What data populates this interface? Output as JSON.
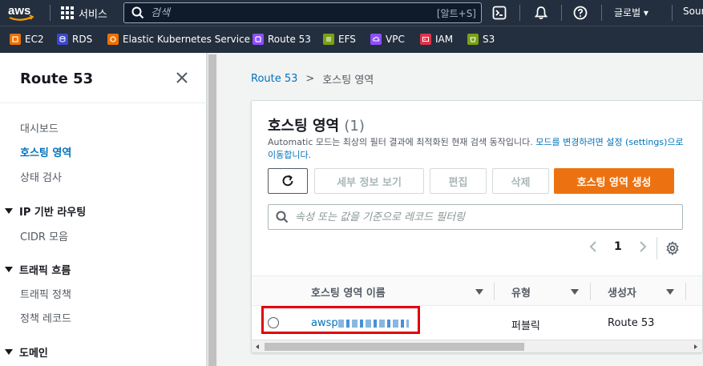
{
  "topnav": {
    "logo_text": "aws",
    "services_label": "서비스",
    "search_placeholder": "검색",
    "search_shortcut": "[알트+S]",
    "region_label": "글로벌 ▾",
    "user_label": "Sour"
  },
  "favorites": [
    {
      "label": "EC2",
      "icon": "ec2-icon",
      "color": "#ed7100"
    },
    {
      "label": "RDS",
      "icon": "rds-icon",
      "color": "#3b48cc"
    },
    {
      "label": "Elastic Kubernetes Service",
      "icon": "eks-icon",
      "color": "#ed7100"
    },
    {
      "label": "Route 53",
      "icon": "route53-icon",
      "color": "#8c4fff"
    },
    {
      "label": "EFS",
      "icon": "efs-icon",
      "color": "#7aa116"
    },
    {
      "label": "VPC",
      "icon": "vpc-icon",
      "color": "#8c4fff"
    },
    {
      "label": "IAM",
      "icon": "iam-icon",
      "color": "#dd344c"
    },
    {
      "label": "S3",
      "icon": "s3-icon",
      "color": "#7aa116"
    }
  ],
  "sidebar": {
    "title": "Route 53",
    "items": [
      {
        "label": "대시보드"
      },
      {
        "label": "호스팅 영역"
      },
      {
        "label": "상태 검사"
      }
    ],
    "sections": [
      {
        "label": "IP 기반 라우팅",
        "items": [
          {
            "label": "CIDR 모음"
          }
        ]
      },
      {
        "label": "트래픽 흐름",
        "items": [
          {
            "label": "트래픽 정책"
          },
          {
            "label": "정책 레코드"
          }
        ]
      },
      {
        "label": "도메인",
        "items": []
      }
    ]
  },
  "breadcrumb": {
    "root": "Route 53",
    "separator": ">",
    "current": "호스팅 영역"
  },
  "panel": {
    "title": "호스팅 영역",
    "count": "(1)",
    "description_part1": "Automatic 모드는 최상의 필터 결과에 최적화된 현재 검색 동작입니다. ",
    "description_link": "모드를 변경하려면 설정 (settings)으로 이동합니다.",
    "buttons": {
      "details": "세부 정보 보기",
      "edit": "편집",
      "delete": "삭제",
      "create": "호스팅 영역 생성"
    },
    "filter_placeholder": "속성 또는 값을 기준으로 레코드 필터링",
    "page_number": "1"
  },
  "table": {
    "columns": [
      "호스팅 영역 이름",
      "유형",
      "생성자"
    ],
    "rows": [
      {
        "name_prefix": "awsp",
        "type": "퍼블릭",
        "created_by": "Route 53"
      }
    ]
  }
}
